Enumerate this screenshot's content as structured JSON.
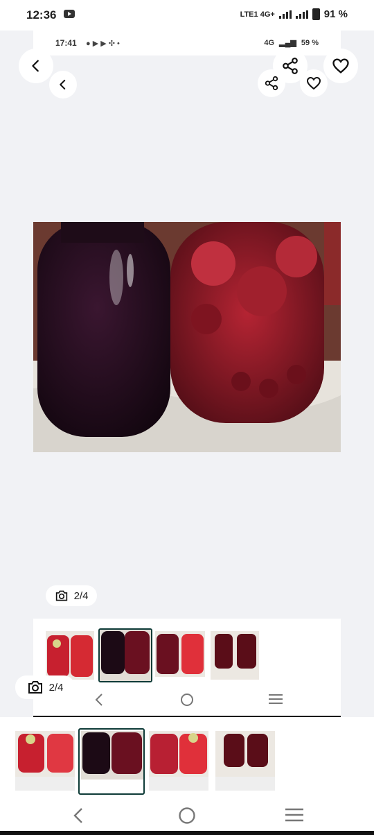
{
  "status_bar": {
    "time": "12:36",
    "network": "LTE1 4G+",
    "battery": "91 %"
  },
  "inner_status_bar": {
    "time": "17:41",
    "network": "4G",
    "battery": "59 %"
  },
  "gallery": {
    "counter_inner": "2/4",
    "counter_outer": "2/4",
    "selected_index": 2,
    "total": 4
  },
  "icons": {
    "back": "back-arrow-icon",
    "share": "share-icon",
    "favorite": "heart-icon",
    "camera": "camera-icon",
    "nav_back": "nav-back-icon",
    "nav_home": "nav-home-icon",
    "nav_recents": "nav-recents-icon"
  },
  "colors": {
    "background": "#f1f2f5",
    "surface": "#ffffff",
    "selected_border": "#0e3b37"
  }
}
